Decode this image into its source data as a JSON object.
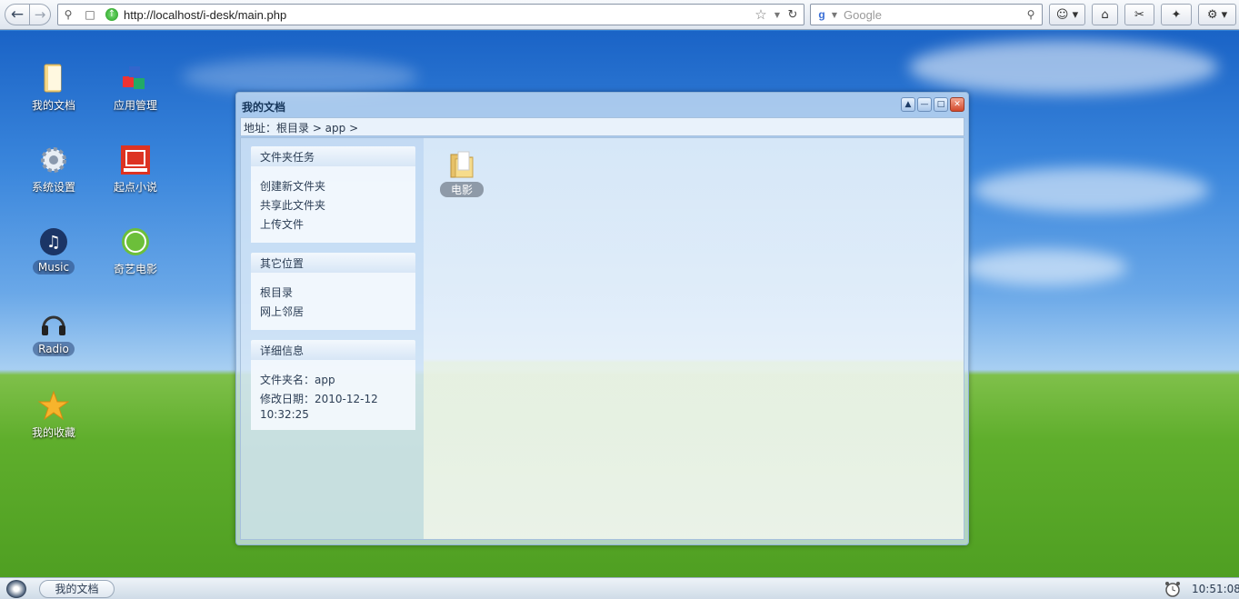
{
  "browser": {
    "url": "http://localhost/i-desk/main.php",
    "search_placeholder": "Google"
  },
  "desktop_icons": [
    {
      "label": "我的文档",
      "icon": "documents-icon"
    },
    {
      "label": "应用管理",
      "icon": "app-manager-icon"
    },
    {
      "label": "系统设置",
      "icon": "gear-icon"
    },
    {
      "label": "起点小说",
      "icon": "qidian-novel-icon"
    },
    {
      "label": "Music",
      "icon": "music-icon"
    },
    {
      "label": "奇艺电影",
      "icon": "qiyi-movie-icon"
    },
    {
      "label": "Radio",
      "icon": "headphones-icon"
    },
    {
      "label": "我的收藏",
      "icon": "star-icon"
    }
  ],
  "window": {
    "title": "我的文档",
    "address": "地址：根目录 > app >",
    "panels": {
      "folder_tasks": {
        "title": "文件夹任务",
        "items": [
          "创建新文件夹",
          "共享此文件夹",
          "上传文件"
        ]
      },
      "other_places": {
        "title": "其它位置",
        "items": [
          "根目录",
          "网上邻居"
        ]
      },
      "details": {
        "title": "详细信息",
        "name": "文件夹名：app",
        "date": "修改日期：2010-12-12",
        "time": "10:32:25"
      }
    },
    "folders": [
      {
        "label": "电影",
        "icon": "folder-icon"
      }
    ]
  },
  "taskbar": {
    "tasks": [
      "我的文档"
    ],
    "clock": "10:51:08"
  }
}
